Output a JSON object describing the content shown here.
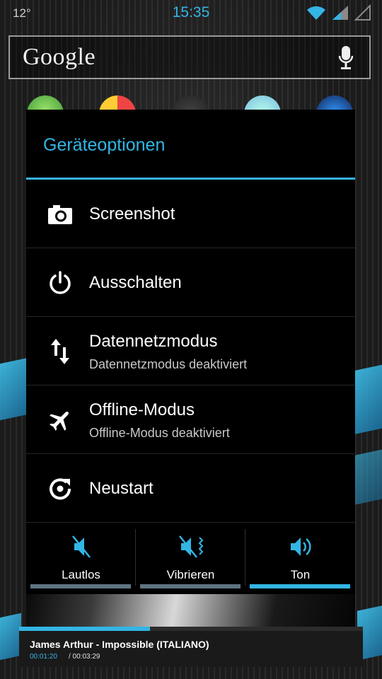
{
  "status": {
    "temperature": "12°",
    "time": "15:35",
    "icons": [
      "wifi-icon",
      "signal-icon",
      "data-icon"
    ]
  },
  "search": {
    "logo": "Google",
    "mic_icon": "mic-icon"
  },
  "dialog": {
    "title": "Geräteoptionen",
    "items": [
      {
        "icon": "camera-icon",
        "label": "Screenshot"
      },
      {
        "icon": "power-icon",
        "label": "Ausschalten"
      },
      {
        "icon": "data-arrows-icon",
        "label": "Datennetzmodus",
        "subtitle": "Datennetzmodus deaktiviert"
      },
      {
        "icon": "airplane-icon",
        "label": "Offline-Modus",
        "subtitle": "Offline-Modus deaktiviert"
      },
      {
        "icon": "restart-icon",
        "label": "Neustart"
      }
    ],
    "sound_modes": [
      {
        "icon": "mute-icon",
        "label": "Lautlos",
        "active": false
      },
      {
        "icon": "vibrate-icon",
        "label": "Vibrieren",
        "active": false
      },
      {
        "icon": "sound-icon",
        "label": "Ton",
        "active": true
      }
    ]
  },
  "player": {
    "track": "James Arthur - Impossible (ITALIANO)",
    "current_time": "00:01:20",
    "total_time": "/ 00:03:29",
    "progress": 0.38
  },
  "colors": {
    "accent": "#33b5e5",
    "dialog_bg": "#000000",
    "inactive_bar": "#5f7480"
  }
}
